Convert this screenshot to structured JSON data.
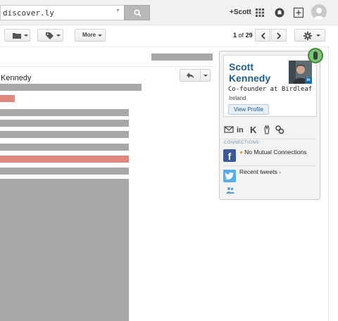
{
  "search": {
    "value": "discover.ly"
  },
  "topbar": {
    "plus_name": "+Scott"
  },
  "toolbar": {
    "more_label": "More"
  },
  "pagination": {
    "current": "1",
    "of_label": "of",
    "total": "29"
  },
  "message": {
    "sender": "Kennedy"
  },
  "profile": {
    "name_line1": "Scott",
    "name_line2": "Kennedy",
    "tagline": "Co-founder at Birdleaf",
    "location": "Ireland",
    "view_profile_label": "View Profile",
    "photo_badge": "in"
  },
  "connections": {
    "label": "CONNECTIONS:",
    "facebook_glyph": "f",
    "mutual_text": "No Mutual Connections"
  },
  "twitter": {
    "recent_label": "Recent tweets",
    "arrow": "›"
  },
  "colors": {
    "accent_blue": "#1f5d8e",
    "redacted_gray": "#a8a8a8",
    "redacted_red": "#e0867a",
    "facebook": "#3b5998",
    "twitter": "#55acee",
    "badge_green": "#7fc07a"
  },
  "icons": [
    "search-icon",
    "apps-grid-icon",
    "notifications-icon",
    "share-plus-icon",
    "avatar",
    "folder-icon",
    "label-icon",
    "chevron-left-icon",
    "chevron-right-icon",
    "gear-icon",
    "reply-icon",
    "mail-icon",
    "linkedin-icon",
    "klout-icon",
    "angellist-icon",
    "link-icon",
    "facebook-icon",
    "twitter-icon",
    "people-icon"
  ]
}
